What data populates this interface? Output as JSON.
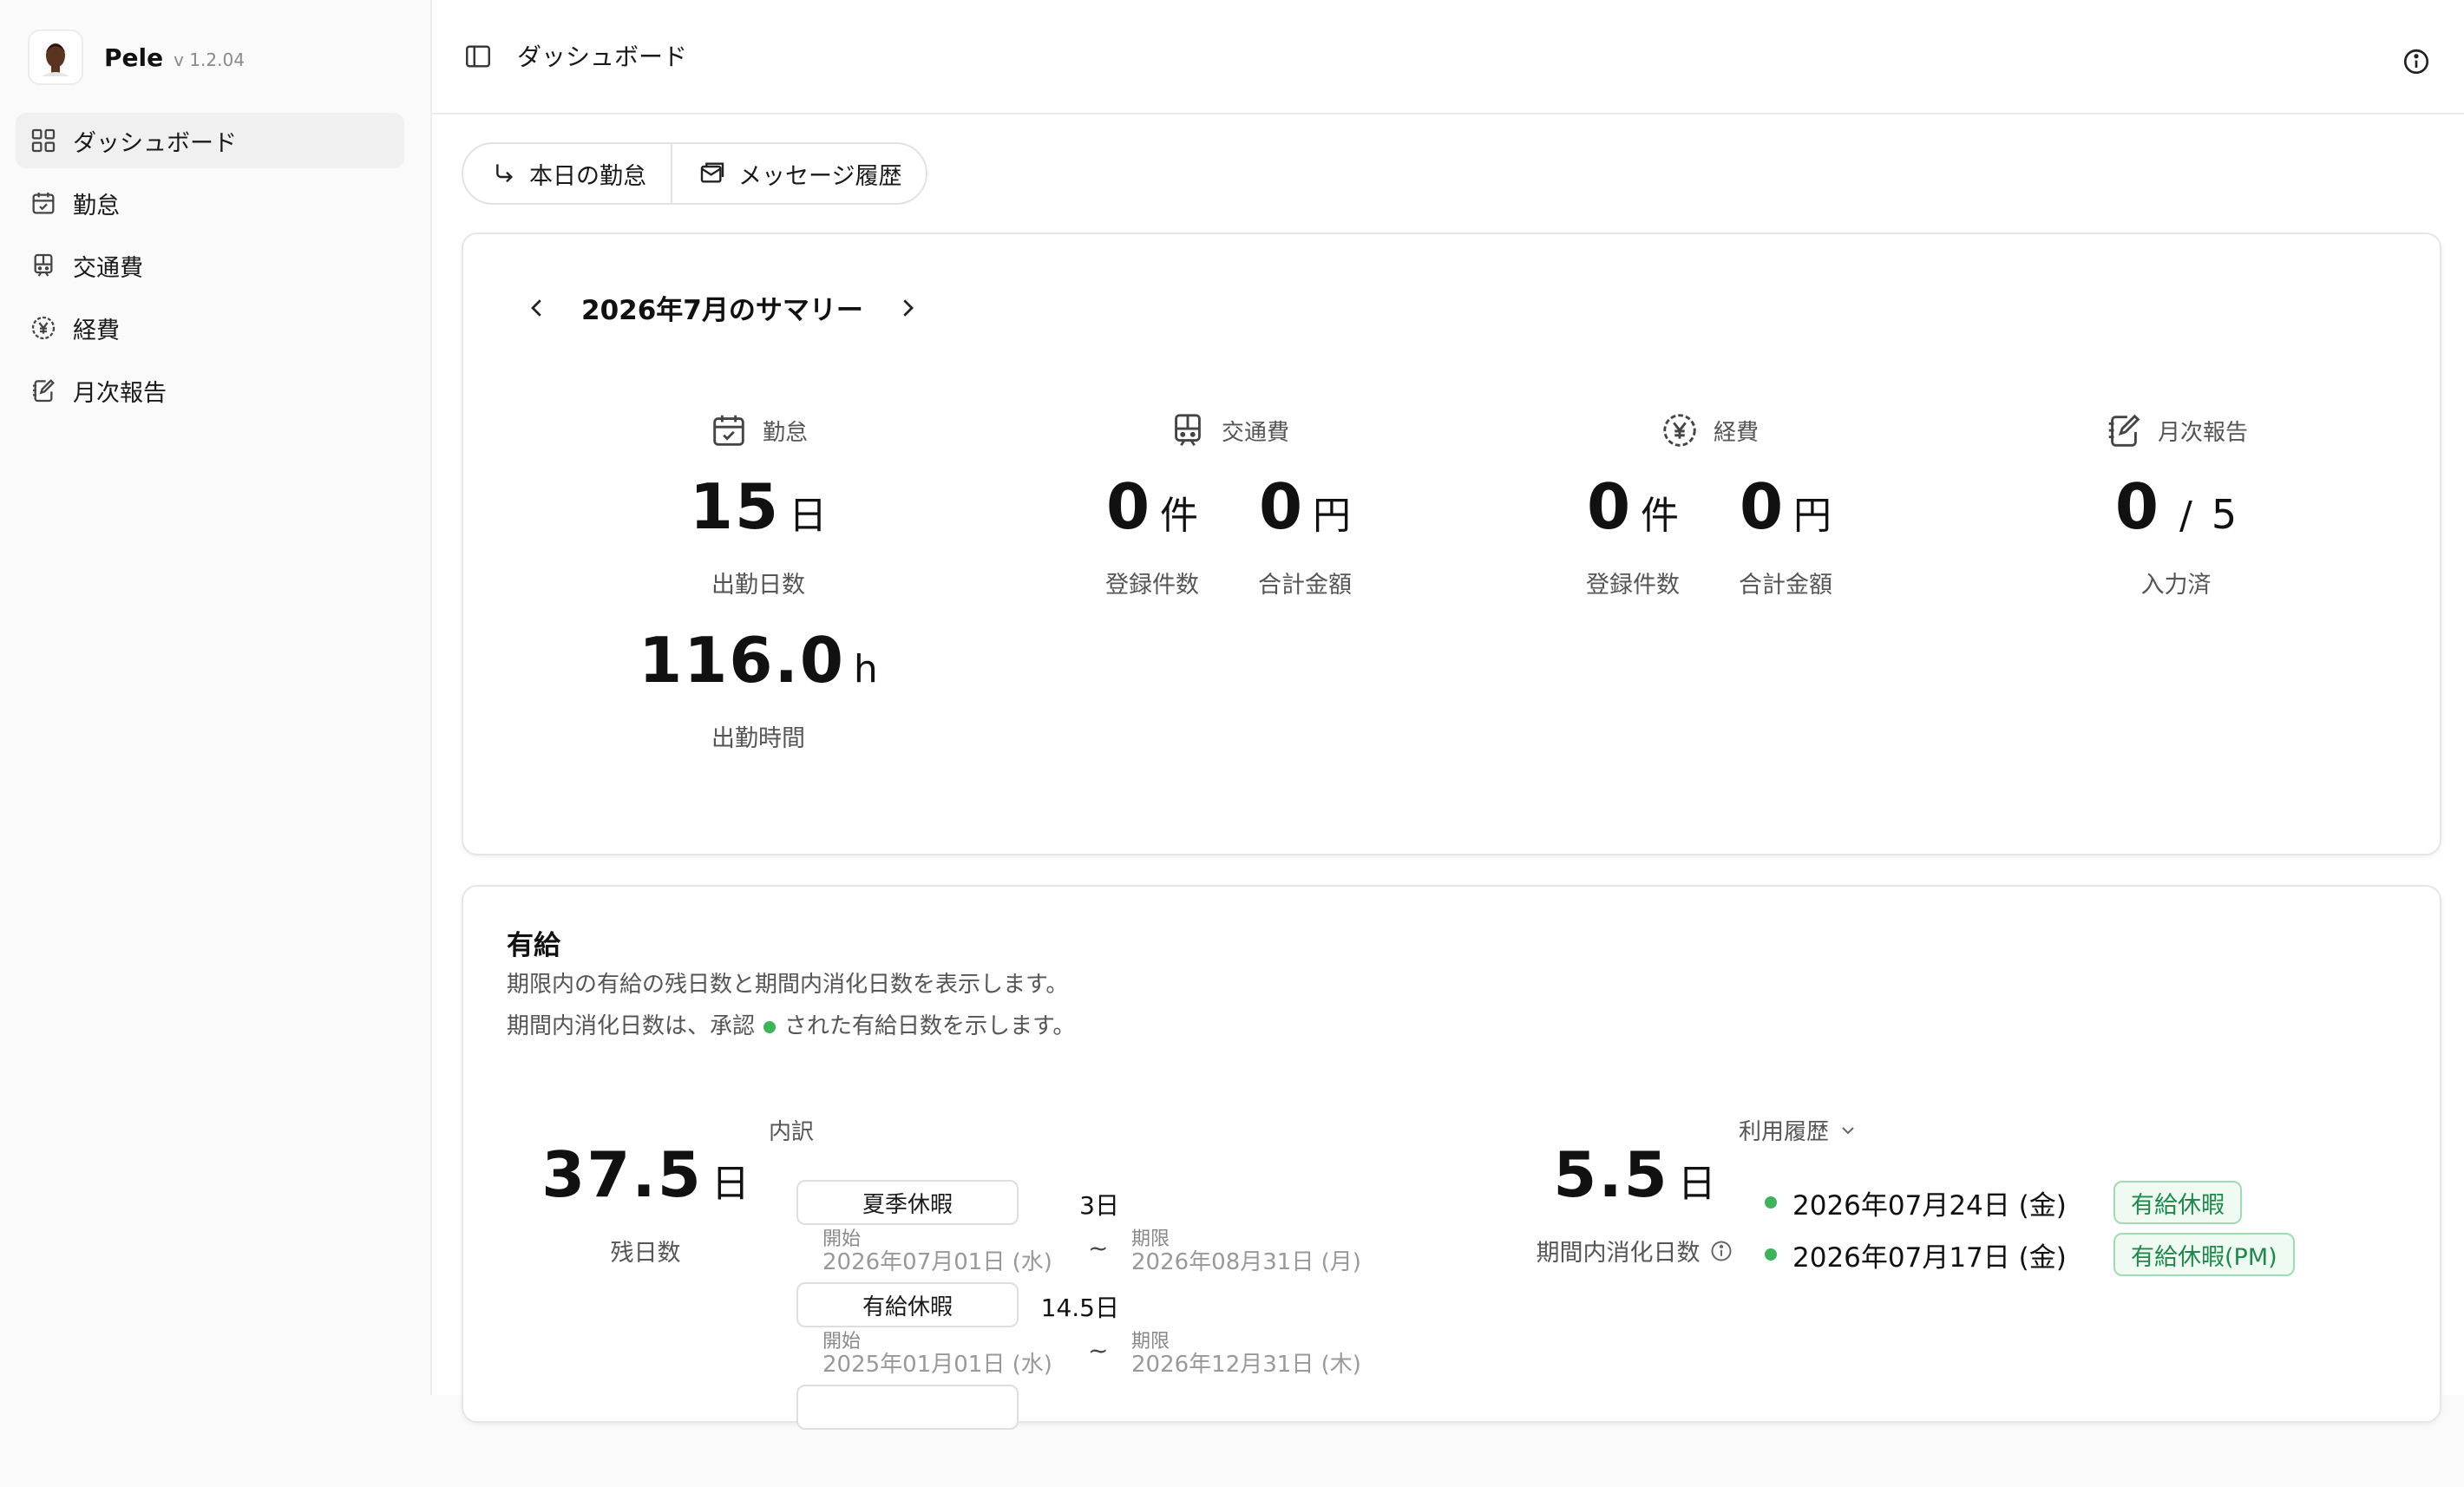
{
  "app": {
    "name": "Pele",
    "version": "v 1.2.04"
  },
  "sidebar": {
    "items": [
      {
        "label": "ダッシュボード",
        "icon": "grid-icon"
      },
      {
        "label": "勤怠",
        "icon": "calendar-check-icon"
      },
      {
        "label": "交通費",
        "icon": "train-icon"
      },
      {
        "label": "経費",
        "icon": "yen-circle-icon"
      },
      {
        "label": "月次報告",
        "icon": "notebook-edit-icon"
      }
    ],
    "active_index": 0
  },
  "header": {
    "title": "ダッシュボード"
  },
  "tabs": [
    {
      "label": "本日の勤怠",
      "icon": "arrow-corner-icon"
    },
    {
      "label": "メッセージ履歴",
      "icon": "mail-open-icon"
    }
  ],
  "summary": {
    "title": "2026年7月のサマリー",
    "attendance": {
      "label": "勤怠",
      "days_value": "15",
      "days_unit": "日",
      "days_label": "出勤日数",
      "hours_value": "116.0",
      "hours_unit": "h",
      "hours_label": "出勤時間"
    },
    "transport": {
      "label": "交通費",
      "count_value": "0",
      "count_unit": "件",
      "count_label": "登録件数",
      "amount_value": "0",
      "amount_unit": "円",
      "amount_label": "合計金額"
    },
    "expense": {
      "label": "経費",
      "count_value": "0",
      "count_unit": "件",
      "count_label": "登録件数",
      "amount_value": "0",
      "amount_unit": "円",
      "amount_label": "合計金額"
    },
    "monthly_report": {
      "label": "月次報告",
      "done_value": "0",
      "separator": "/",
      "total_value": "5",
      "done_label": "入力済"
    }
  },
  "paid_leave": {
    "title": "有給",
    "description_1": "期限内の有給の残日数と期間内消化日数を表示します。",
    "description_2_before": "期間内消化日数は、承認",
    "description_2_after": "された有給日数を示します。",
    "remaining_value": "37.5",
    "remaining_unit": "日",
    "remaining_label": "残日数",
    "breakdown_title": "内訳",
    "breakdown": [
      {
        "name": "夏季休暇",
        "days": "3日",
        "start_label": "開始",
        "start": "2026年07月01日 (水)",
        "tilde": "~",
        "end_label": "期限",
        "end": "2026年08月31日 (月)"
      },
      {
        "name": "有給休暇",
        "days": "14.5日",
        "start_label": "開始",
        "start": "2025年01月01日 (水)",
        "tilde": "~",
        "end_label": "期限",
        "end": "2026年12月31日 (木)"
      }
    ],
    "consumed_value": "5.5",
    "consumed_unit": "日",
    "consumed_label": "期間内消化日数",
    "history_label": "利用履歴",
    "history": [
      {
        "date": "2026年07月24日 (金)",
        "type": "有給休暇"
      },
      {
        "date": "2026年07月17日 (金)",
        "type": "有給休暇(PM)"
      }
    ]
  },
  "colors": {
    "approved_dot": "#3cb55a",
    "badge_text": "#1e8a4a",
    "badge_border": "#9fdcb6"
  }
}
